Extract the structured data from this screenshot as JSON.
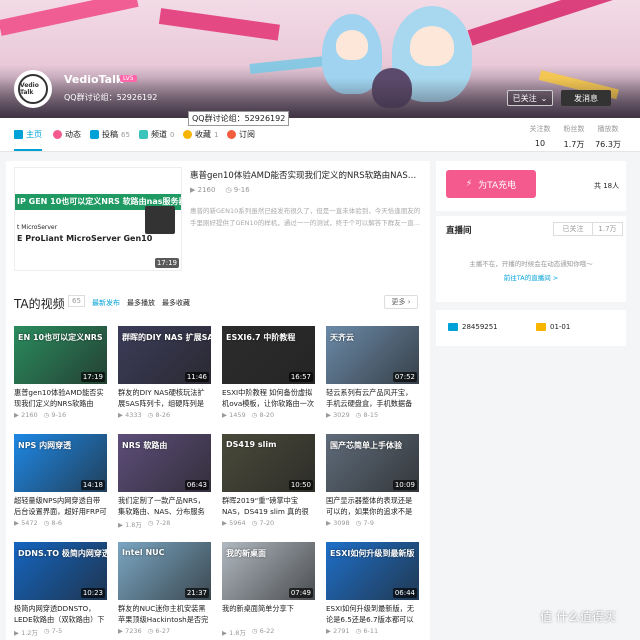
{
  "header": {
    "username": "VedioTalk",
    "level": "LV5",
    "qq": "QQ群讨论组：52926192",
    "tooltip": "QQ群讨论组：52926192",
    "follow_label": "已关注",
    "message_label": "发消息",
    "avatar_text": "Vedio Talk"
  },
  "nav": {
    "tabs": [
      {
        "label": "主页",
        "count": ""
      },
      {
        "label": "动态",
        "count": ""
      },
      {
        "label": "投稿",
        "count": "65"
      },
      {
        "label": "频道",
        "count": "0"
      },
      {
        "label": "收藏",
        "count": "1"
      },
      {
        "label": "订阅",
        "count": ""
      }
    ],
    "stats": [
      {
        "label": "关注数",
        "value": "10"
      },
      {
        "label": "粉丝数",
        "value": "1.7万"
      },
      {
        "label": "播放数",
        "value": "76.3万"
      }
    ]
  },
  "featured": {
    "thumb_bar": "IP GEN 10也可以定义NRS 软路由nas服务器",
    "thumb_sub1": "t MicroServer",
    "thumb_sub2": "E ProLiant MicroServer Gen10",
    "duration": "17:19",
    "title": "惠普gen10体验AMD能否实现我们定义的NRS软路由NAS服务...",
    "plays": "2160",
    "date": "9-16",
    "desc": "惠普的新GEN10系列虽然已经发布很久了，但是一直未体验到，今天恰逢朋友的手里刚好提供了GEN10的样机，通过一一的测试，终于个可以解答下群友一直..."
  },
  "videos_section": {
    "title": "TA的视频",
    "count": "65",
    "sort_latest": "最新发布",
    "sort_plays": "最多播放",
    "sort_favs": "最多收藏",
    "more": "更多"
  },
  "videos": [
    {
      "thumb": "EN 10也可以定义NRS",
      "duration": "17:19",
      "title": "惠普gen10体验AMD能否实现我们定义的NRS软路由NAS",
      "plays": "2160",
      "date": "9-16",
      "color": "#2a8c5e"
    },
    {
      "thumb": "群晖的DIY NAS 扩展SAS",
      "duration": "11:46",
      "title": "群友的DIY NAS硬核玩法扩展SAS阵列卡，组硬阵列是个什",
      "plays": "4333",
      "date": "8-26",
      "color": "#3c3c5a"
    },
    {
      "thumb": "ESXI6.7 中阶教程",
      "duration": "16:57",
      "title": "ESXI中阶教程 如何备份虚拟机ova模板，让你软路由一次",
      "plays": "1459",
      "date": "8-20",
      "color": "#2c2c2c"
    },
    {
      "thumb": "天齐云",
      "duration": "07:52",
      "title": "轻云系列有云产品风开宝，手机云硬盘盒，手机数据备份恢",
      "plays": "3029",
      "date": "8-15",
      "color": "#6b8aa8"
    },
    {
      "thumb": "NPS 内网穿透",
      "duration": "14:18",
      "title": "超轻量级NPS内网穿透自带后台设置界面，超好用FRP可以",
      "plays": "5472",
      "date": "8-6",
      "color": "#1e88e5"
    },
    {
      "thumb": "NRS 软路由",
      "duration": "06:43",
      "title": "我们定制了一款产品NRS，集软路由、NAS、分布服务器于",
      "plays": "1.8万",
      "date": "7-28",
      "color": "#5d4e7a"
    },
    {
      "thumb": "DS419 slim",
      "duration": "10:50",
      "title": "群晖2019“重”磅掌中宝NAS，DS419 slim 真的很适",
      "plays": "5964",
      "date": "7-20",
      "color": "#4a4a3a"
    },
    {
      "thumb": "国产芯简单上手体验",
      "duration": "10:09",
      "title": "国产显示器整体的表现还是可以的，如果你的追求不是特别",
      "plays": "3098",
      "date": "7-9",
      "color": "#5f6c7a"
    },
    {
      "thumb": "DDNS.TO 极简内网穿透",
      "duration": "10:23",
      "title": "极简内网穿透DDNSTO，LEDE软路由（双软路由）下",
      "plays": "1.2万",
      "date": "7-5",
      "color": "#1565c0"
    },
    {
      "thumb": "Intel NUC",
      "duration": "21:37",
      "title": "群友的NUC迷你主机安装黑苹果顶级Hackintosh是否完美",
      "plays": "7236",
      "date": "6-27",
      "color": "#7aa6c2"
    },
    {
      "thumb": "我的新桌面",
      "duration": "07:49",
      "title": "我的新桌面简单分享下",
      "plays": "1.8万",
      "date": "6-22",
      "color": "#b0b8c0"
    },
    {
      "thumb": "ESXI如何升级到最新版",
      "duration": "06:44",
      "title": "ESXI如何升级到最新版，无论是6.5还是6.7版本都可以这",
      "plays": "2791",
      "date": "6-11",
      "color": "#1e6fc8"
    }
  ],
  "sidebar": {
    "charge_label": "为TA充电",
    "total": "共 18人",
    "live_title": "直播间",
    "live_follow": "已关注",
    "live_count": "1.7万",
    "live_msg": "主播不在，开播的时候会在动态通知你哦～",
    "live_link": "前往TA的直播间 >",
    "uid": "28459251",
    "birthday": "01-01"
  },
  "watermark": "值 什么值得买"
}
